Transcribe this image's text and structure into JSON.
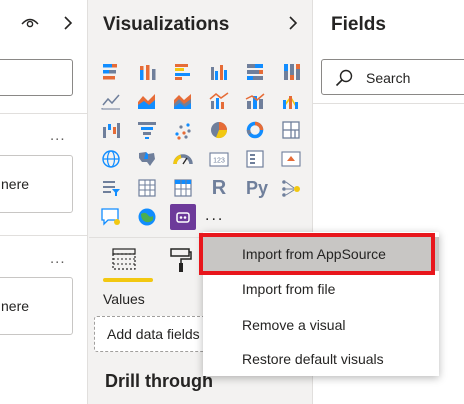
{
  "filters_pane": {
    "card1_text": "nere",
    "card2_text": "nere",
    "more1": "...",
    "more2": "..."
  },
  "visualizations": {
    "title": "Visualizations",
    "more": "...",
    "r_label": "R",
    "py_label": "Py",
    "values_label": "Values",
    "dropzone_placeholder": "Add data fields",
    "drill_through_label": "Drill through",
    "icons": [
      "stacked-bar-icon",
      "stacked-column-icon",
      "clustered-bar-icon",
      "clustered-column-icon",
      "100-stacked-bar-icon",
      "100-stacked-column-icon",
      "line-chart-icon",
      "area-chart-icon",
      "stacked-area-icon",
      "line-clustered-column-icon",
      "line-stacked-column-icon",
      "ribbon-chart-icon",
      "waterfall-icon",
      "funnel-icon",
      "scatter-icon",
      "pie-icon",
      "donut-icon",
      "treemap-icon",
      "map-icon",
      "filled-map-icon",
      "gauge-icon",
      "card-icon",
      "multirow-card-icon",
      "kpi-icon",
      "slicer-icon",
      "table-icon",
      "matrix-icon",
      "r-visual-icon",
      "python-visual-icon",
      "key-influencers-icon",
      "qa-icon",
      "arcgis-icon",
      "power-apps-icon"
    ],
    "colors": {
      "accent_yellow": "#f2c811",
      "viz_blue": "#118dff",
      "viz_orange": "#e66c37",
      "viz_gray": "#6f7f9b",
      "selected_purple": "#6d3a9a"
    }
  },
  "fields": {
    "title": "Fields",
    "search_placeholder": "Search"
  },
  "context_menu": {
    "items": [
      {
        "label": "Import from AppSource",
        "state": "hovered"
      },
      {
        "label": "Import from file"
      },
      {
        "label": "Remove a visual"
      },
      {
        "label": "Restore default visuals"
      }
    ],
    "highlight_color": "#e8161c"
  }
}
